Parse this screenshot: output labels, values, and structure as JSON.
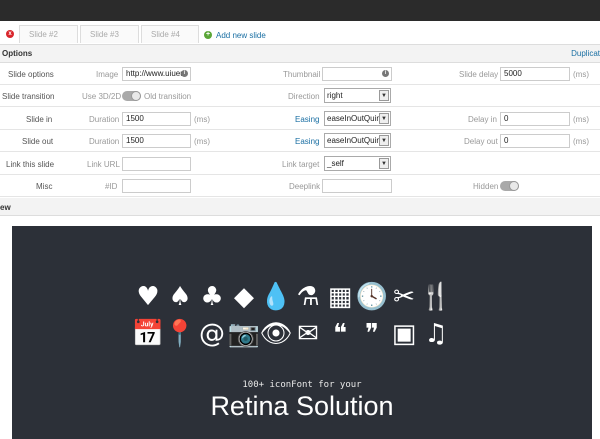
{
  "tabs": [
    {
      "label": "Slide #2"
    },
    {
      "label": "Slide #3"
    },
    {
      "label": "Slide #4"
    }
  ],
  "add_slide_label": "Add new slide",
  "options": {
    "title": "Options",
    "duplicate_label": "Duplicat"
  },
  "rows": {
    "slide_options": {
      "label": "Slide options",
      "image_label": "Image",
      "image_value": "http://www.uiueu.",
      "thumbnail_label": "Thumbnail",
      "thumbnail_value": "",
      "delay_label": "Slide delay",
      "delay_value": "5000",
      "delay_unit": "(ms)"
    },
    "slide_transition": {
      "label": "Slide transition",
      "use3d_label": "Use 3D/2D",
      "old_transition_label": "Old transition",
      "direction_label": "Direction",
      "direction_value": "right"
    },
    "slide_in": {
      "label": "Slide in",
      "duration_label": "Duration",
      "duration_value": "1500",
      "duration_unit": "(ms)",
      "easing_label": "Easing",
      "easing_value": "easeInOutQuint",
      "delay_label": "Delay in",
      "delay_value": "0",
      "delay_unit": "(ms)"
    },
    "slide_out": {
      "label": "Slide out",
      "duration_label": "Duration",
      "duration_value": "1500",
      "duration_unit": "(ms)",
      "easing_label": "Easing",
      "easing_value": "easeInOutQuint",
      "delay_label": "Delay out",
      "delay_value": "0",
      "delay_unit": "(ms)"
    },
    "link": {
      "label": "Link this slide",
      "url_label": "Link URL",
      "url_value": "",
      "target_label": "Link target",
      "target_value": "_self"
    },
    "misc": {
      "label": "Misc",
      "id_label": "#ID",
      "id_value": "",
      "deeplink_label": "Deeplink",
      "deeplink_value": "",
      "hidden_label": "Hidden"
    }
  },
  "preview": {
    "title": "ew",
    "icons_row1": [
      {
        "name": "heart-icon",
        "glyph": "♥"
      },
      {
        "name": "spade-icon",
        "glyph": "♠"
      },
      {
        "name": "club-icon",
        "glyph": "♣"
      },
      {
        "name": "diamond-icon",
        "glyph": "◆"
      },
      {
        "name": "drop-icon",
        "glyph": "💧"
      },
      {
        "name": "flask-icon",
        "glyph": "⚗"
      },
      {
        "name": "grid-icon",
        "glyph": "▦"
      },
      {
        "name": "clock-icon",
        "glyph": "🕓"
      },
      {
        "name": "scissors-icon",
        "glyph": "✂"
      },
      {
        "name": "fork-knife-icon",
        "glyph": "🍴"
      }
    ],
    "icons_row2": [
      {
        "name": "calendar-icon",
        "glyph": "📅"
      },
      {
        "name": "map-pin-icon",
        "glyph": "📍"
      },
      {
        "name": "at-icon",
        "glyph": "@"
      },
      {
        "name": "camera-icon",
        "glyph": "📷"
      },
      {
        "name": "eye-icon",
        "glyph": "👁"
      },
      {
        "name": "envelope-icon",
        "glyph": "✉"
      },
      {
        "name": "quote-open-icon",
        "glyph": "❝"
      },
      {
        "name": "quote-close-icon",
        "glyph": "❞"
      },
      {
        "name": "picture-icon",
        "glyph": "▣"
      },
      {
        "name": "music-note-icon",
        "glyph": "♫"
      }
    ],
    "caption_small": "100+ iconFont for your",
    "caption_big": "Retina Solution"
  }
}
